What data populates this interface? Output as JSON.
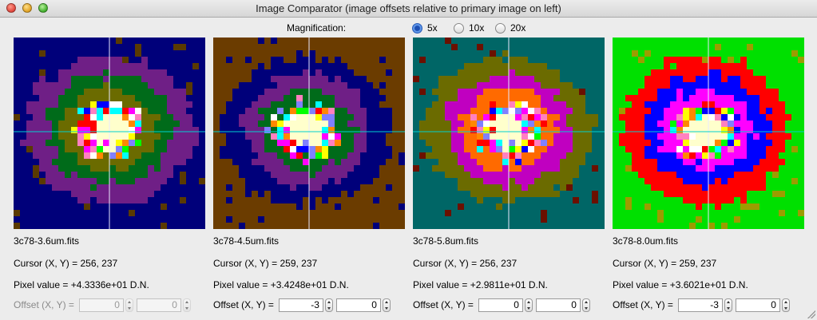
{
  "window": {
    "title": "Image Comparator (image offsets relative to primary image on left)"
  },
  "magnification": {
    "label": "Magnification:",
    "options": [
      {
        "label": "5x",
        "selected": true
      },
      {
        "label": "10x",
        "selected": false
      },
      {
        "label": "20x",
        "selected": false
      }
    ]
  },
  "panels": [
    {
      "filename": "3c78-3.6um.fits",
      "cursor": "Cursor (X, Y) = 256, 237",
      "pixel": "Pixel value = +4.3336e+01 D.N.",
      "offset_label": "Offset (X, Y) =",
      "offset_x": "0",
      "offset_y": "0",
      "enabled": false,
      "palette": {
        "bg": "#00007a",
        "ring1": "#6f1f86",
        "ring2": "#006b1a",
        "ring3": "#6b6b00",
        "center": "#ffffcc",
        "extra": "#5a3a00"
      }
    },
    {
      "filename": "3c78-4.5um.fits",
      "cursor": "Cursor (X, Y) = 259, 237",
      "pixel": "Pixel value = +3.4248e+01 D.N.",
      "offset_label": "Offset (X, Y) =",
      "offset_x": "-3",
      "offset_y": "0",
      "enabled": true,
      "palette": {
        "bg": "#6b3c00",
        "ring1": "#00007a",
        "ring2": "#6f1f86",
        "ring3": "#006b1a",
        "center": "#ffffcc",
        "extra": "#00007a"
      }
    },
    {
      "filename": "3c78-5.8um.fits",
      "cursor": "Cursor (X, Y) = 256, 237",
      "pixel": "Pixel value = +2.9811e+01 D.N.",
      "offset_label": "Offset (X, Y) =",
      "offset_x": "0",
      "offset_y": "0",
      "enabled": true,
      "palette": {
        "bg": "#006666",
        "ring1": "#6b6b00",
        "ring2": "#c000c0",
        "ring3": "#ff6a00",
        "center": "#ffffcc",
        "extra": "#6b1000"
      }
    },
    {
      "filename": "3c78-8.0um.fits",
      "cursor": "Cursor (X, Y) = 259, 237",
      "pixel": "Pixel value = +3.6021e+01 D.N.",
      "offset_label": "Offset (X, Y) =",
      "offset_x": "-3",
      "offset_y": "0",
      "enabled": true,
      "palette": {
        "bg": "#00e000",
        "ring1": "#ff0000",
        "ring2": "#0000ff",
        "ring3": "#ff00ff",
        "center": "#ffffcc",
        "extra": "#9c9c00"
      }
    }
  ]
}
